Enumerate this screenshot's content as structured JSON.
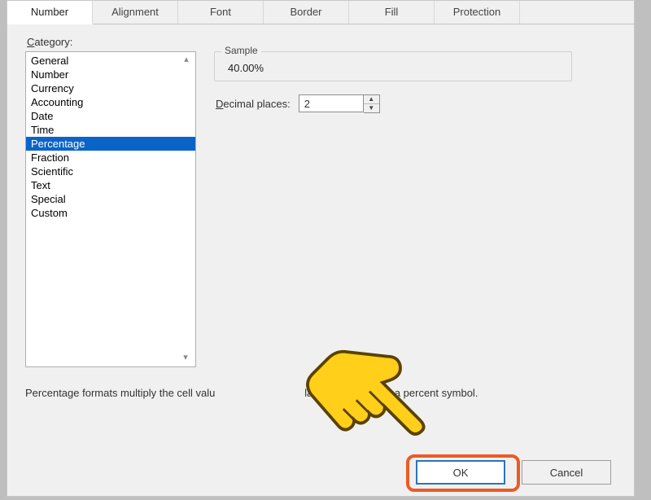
{
  "tabs": {
    "number": "Number",
    "alignment": "Alignment",
    "font": "Font",
    "border": "Border",
    "fill": "Fill",
    "protection": "Protection"
  },
  "labels": {
    "category": "Category:",
    "sample_legend": "Sample",
    "decimal_places": "Decimal places:",
    "description_full": "Percentage formats multiply the cell value by 100 and displays the result with a percent symbol.",
    "description_left": "Percentage formats multiply the cell valu",
    "description_right": "lays the result with a percent symbol."
  },
  "categories": {
    "items": [
      {
        "label": "General"
      },
      {
        "label": "Number"
      },
      {
        "label": "Currency"
      },
      {
        "label": "Accounting"
      },
      {
        "label": "Date"
      },
      {
        "label": "Time"
      },
      {
        "label": "Percentage"
      },
      {
        "label": "Fraction"
      },
      {
        "label": "Scientific"
      },
      {
        "label": "Text"
      },
      {
        "label": "Special"
      },
      {
        "label": "Custom"
      }
    ],
    "selected_index": 6
  },
  "sample_value": "40.00%",
  "decimal_value": "2",
  "buttons": {
    "ok": "OK",
    "cancel": "Cancel"
  }
}
